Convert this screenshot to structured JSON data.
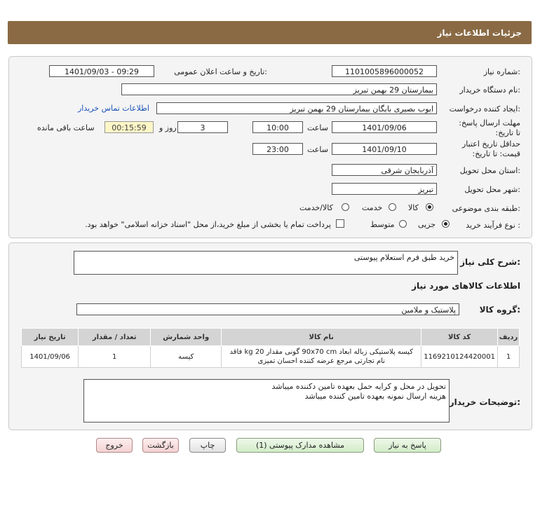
{
  "title": "جزئیات اطلاعات نیاز",
  "form": {
    "need_number_label": "شماره نیاز:",
    "need_number": "1101005896000052",
    "announce_label": "تاریخ و ساعت اعلان عمومی:",
    "announce_value": "1401/09/03 - 09:29",
    "buyer_org_label": "نام دستگاه خریدار:",
    "buyer_org": "بیمارستان 29 بهمن تبریز",
    "requester_label": "ایجاد کننده درخواست:",
    "requester": "ایوب بصیری  بایگان بیمارستان 29 بهمن تبریز",
    "contact_link": "اطلاعات تماس خریدار",
    "deadline_label": "مهلت ارسال پاسخ: تا تاریخ:",
    "deadline_date": "1401/09/06",
    "time_label": "ساعت",
    "deadline_time": "10:00",
    "days": "3",
    "days_label": "روز و",
    "remaining_time": "00:15:59",
    "remaining_label": "ساعت باقی مانده",
    "validity_label": "حداقل تاریخ اعتبار قیمت: تا تاریخ:",
    "validity_date": "1401/09/10",
    "validity_time": "23:00",
    "province_label": "استان محل تحویل:",
    "province": "آذربایجان شرقی",
    "city_label": "شهر محل تحویل:",
    "city": "تبریز",
    "category_label": "طبقه بندی موضوعی:",
    "category_options": [
      "کالا",
      "خدمت",
      "کالا/خدمت"
    ],
    "category_selected": "کالا",
    "process_label": "نوع فرآیند خرید :",
    "process_options": [
      "جزیی",
      "متوسط"
    ],
    "process_selected": "جزیی",
    "payment_note": "پرداخت تمام یا بخشی از مبلغ خرید،از محل \"اسناد خزانه اسلامی\" خواهد بود."
  },
  "summary": {
    "label": "شرح کلی نیاز:",
    "value": "خرید طبق فرم استعلام پیوستی",
    "items_title": "اطلاعات کالاهای مورد نیاز",
    "group_label": "گروه کالا:",
    "group_value": "پلاستیک و ملامین",
    "table": {
      "headers": [
        "ردیف",
        "کد کالا",
        "نام کالا",
        "واحد شمارش",
        "تعداد / مقدار",
        "تاریخ نیاز"
      ],
      "rows": [
        {
          "row": "1",
          "code": "1169210124420001",
          "name_line1": "کیسه پلاستیکی زباله ابعاد 90x70 cm گونی مقدار 20 kg فاقد",
          "name_line2": "نام تجارتی مرجع عرضه کننده احسان تمیزی",
          "unit": "کیسه",
          "qty": "1",
          "date": "1401/09/06"
        }
      ]
    },
    "buyer_notes_label": "توضیحات خریدار:",
    "buyer_notes_line1": "تحویل در محل و کرایه حمل بعهده تامین دکننده میباشد",
    "buyer_notes_line2": "هزینه ارسال نمونه بعهده تامین کننده میباشد"
  },
  "buttons": {
    "reply": "پاسخ به نیاز",
    "attachments": "مشاهده مدارک پیوستی (1)",
    "print": "چاپ",
    "back": "بازگشت",
    "exit": "خروج"
  }
}
